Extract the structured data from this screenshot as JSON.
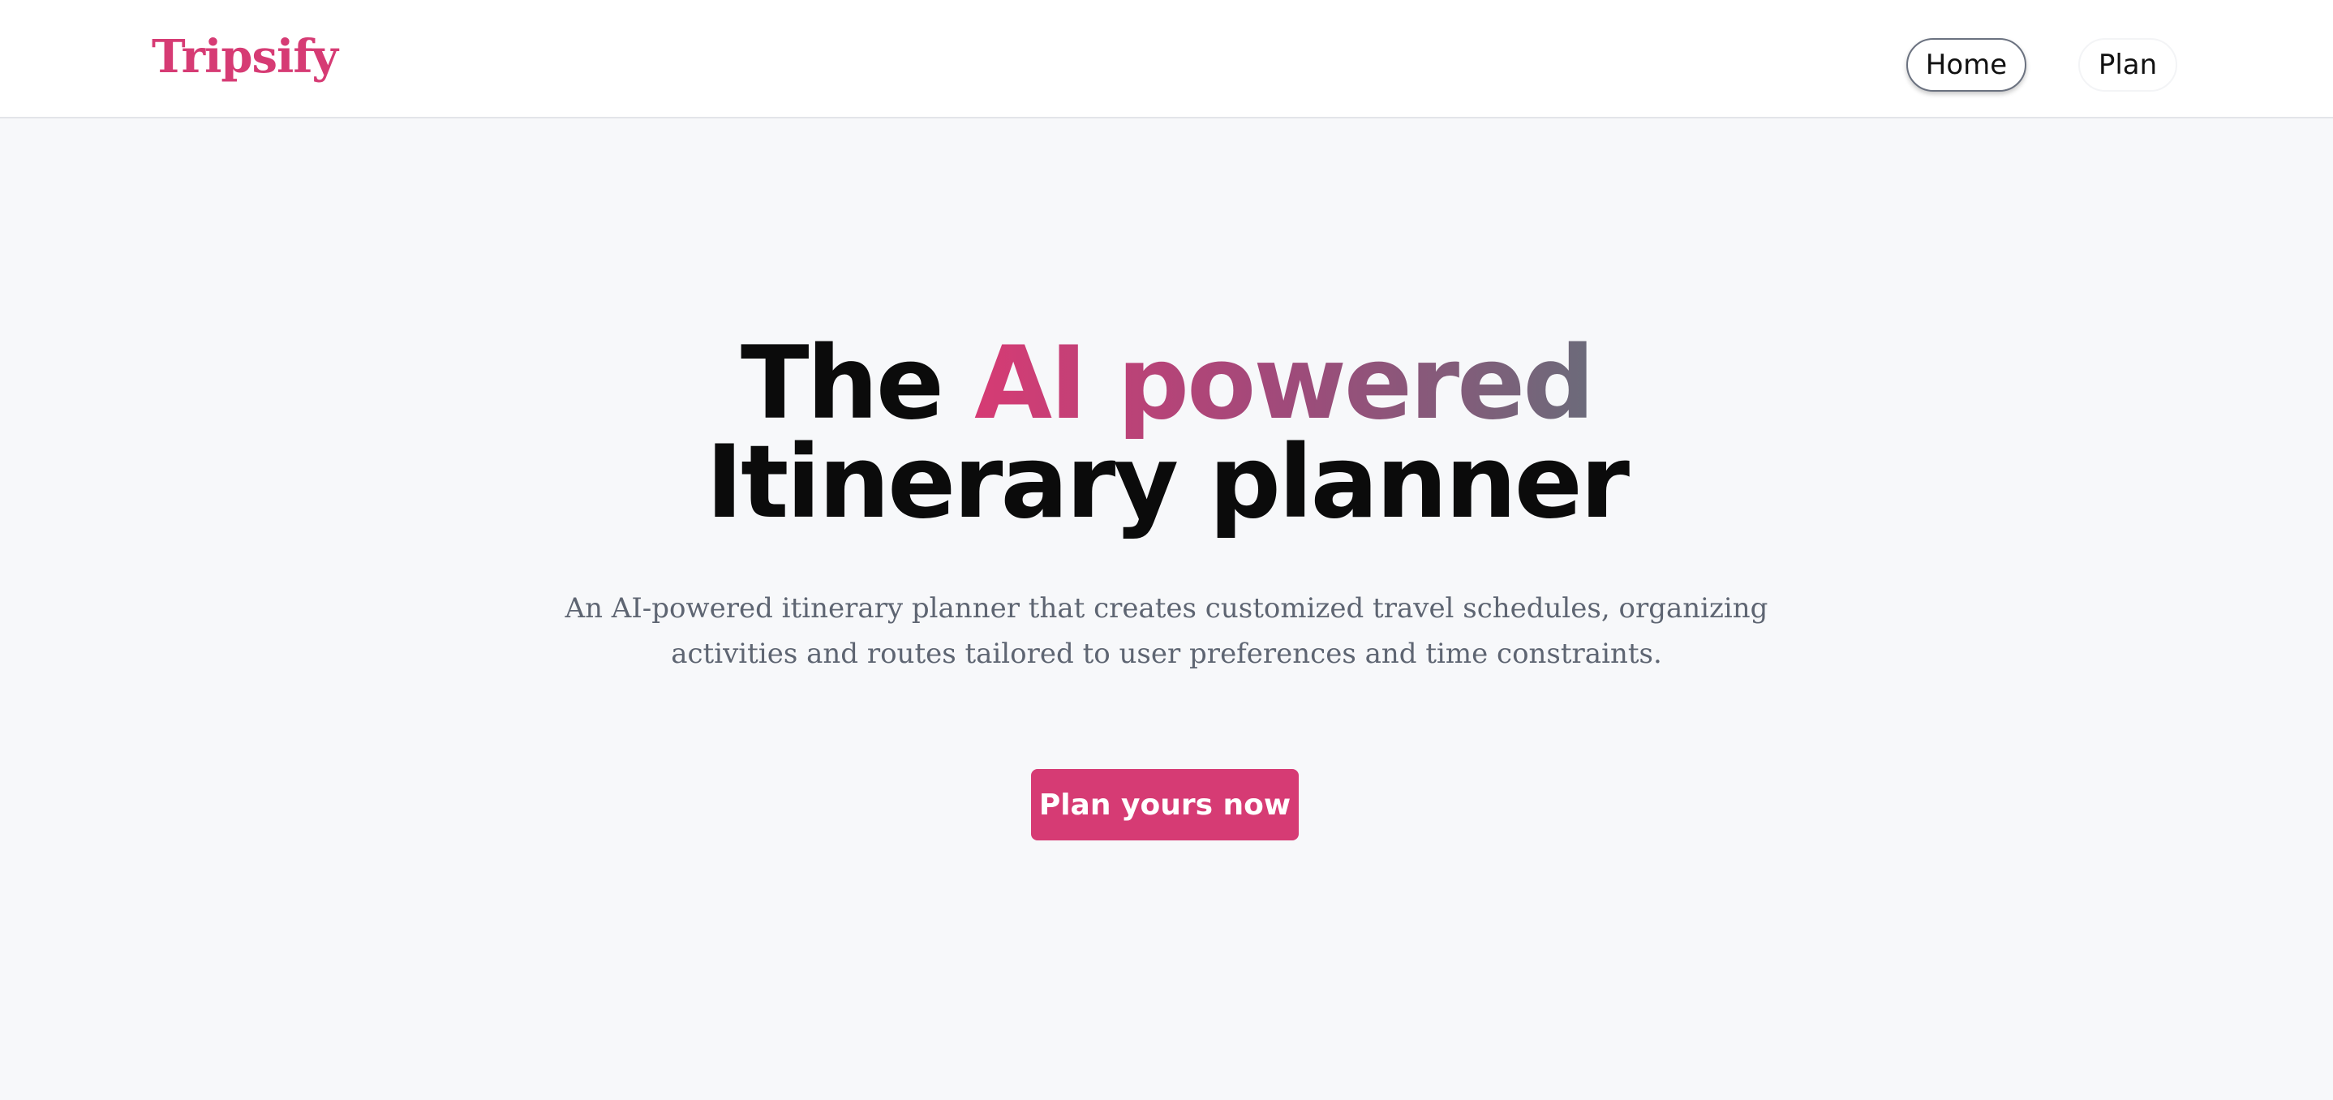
{
  "header": {
    "logo": "Tripsify",
    "nav": [
      {
        "label": "Home",
        "active": true
      },
      {
        "label": "Plan",
        "active": false
      }
    ]
  },
  "hero": {
    "headline_prefix": "The ",
    "headline_highlight": "AI powered",
    "headline_line2": "Itinerary planner",
    "subtitle": "An AI-powered itinerary planner that creates customized travel schedules, organizing activities and routes tailored to user preferences and time constraints.",
    "cta_label": "Plan yours now"
  },
  "colors": {
    "accent": "#d63b74",
    "background": "#f7f8fa",
    "header_bg": "#ffffff",
    "text_dark": "#0b0b0b",
    "text_muted": "#5e6572",
    "gradient_end": "#6b6b7a"
  }
}
